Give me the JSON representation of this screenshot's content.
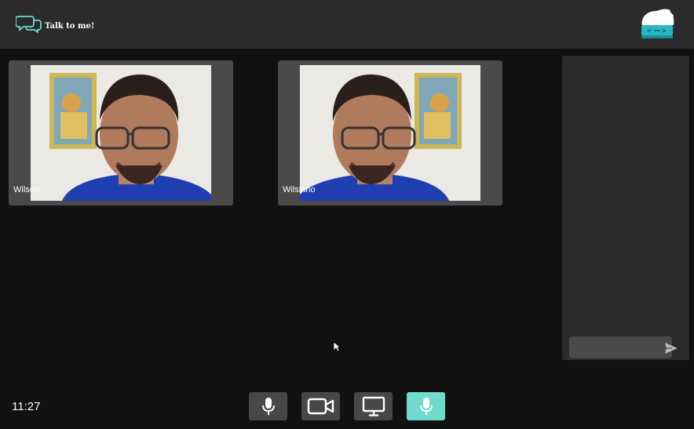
{
  "app": {
    "title": "Talk to me!",
    "accent_color": "#6fdbcd",
    "logo_icon": "chat-bubbles-icon",
    "avatar_icon": "coder-avatar-icon"
  },
  "participants": [
    {
      "name": "Wilson"
    },
    {
      "name": "Wilsinho"
    }
  ],
  "chat": {
    "input_value": "",
    "input_placeholder": "",
    "send_icon": "send-icon"
  },
  "footer": {
    "time": "11:27",
    "controls": [
      {
        "icon": "microphone-icon",
        "active": false
      },
      {
        "icon": "video-camera-icon",
        "active": false
      },
      {
        "icon": "screen-share-icon",
        "active": false
      },
      {
        "icon": "microphone-icon",
        "active": true
      }
    ]
  }
}
